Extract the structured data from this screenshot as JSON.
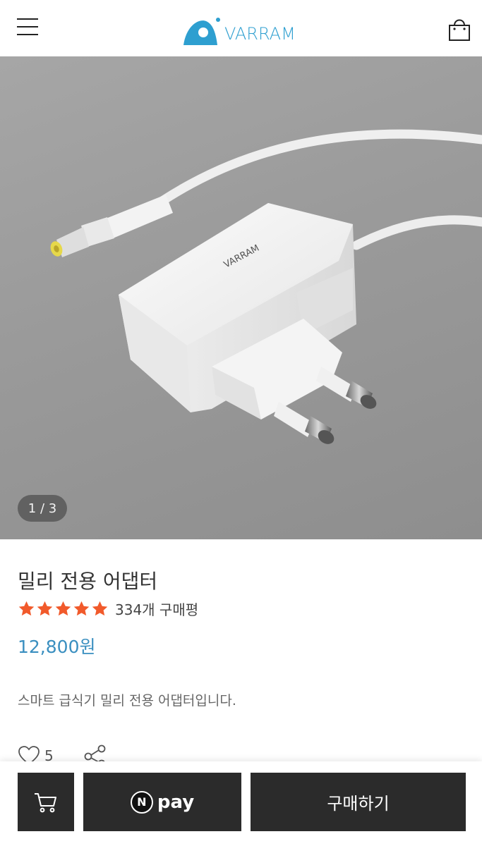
{
  "header": {
    "brand": "VARRAM",
    "menu_icon": "hamburger-menu-icon",
    "cart_icon": "shopping-bag-icon"
  },
  "gallery": {
    "counter": "1 / 3",
    "image_brand": "VARRAM"
  },
  "product": {
    "title": "밀리 전용 어댑터",
    "rating_stars": 5,
    "review_count": "334개 구매평",
    "price": "12,800원",
    "description": "스마트 급식기 밀리 전용 어댑터입니다.",
    "like_count": "5"
  },
  "buy_bar": {
    "npay_badge": "N",
    "npay_label": "pay",
    "buy_label": "구매하기"
  },
  "colors": {
    "brand_blue": "#2e9fd0",
    "price_blue": "#3a8fc0",
    "star_orange": "#f15a2b",
    "button_dark": "#2b2b2b"
  }
}
